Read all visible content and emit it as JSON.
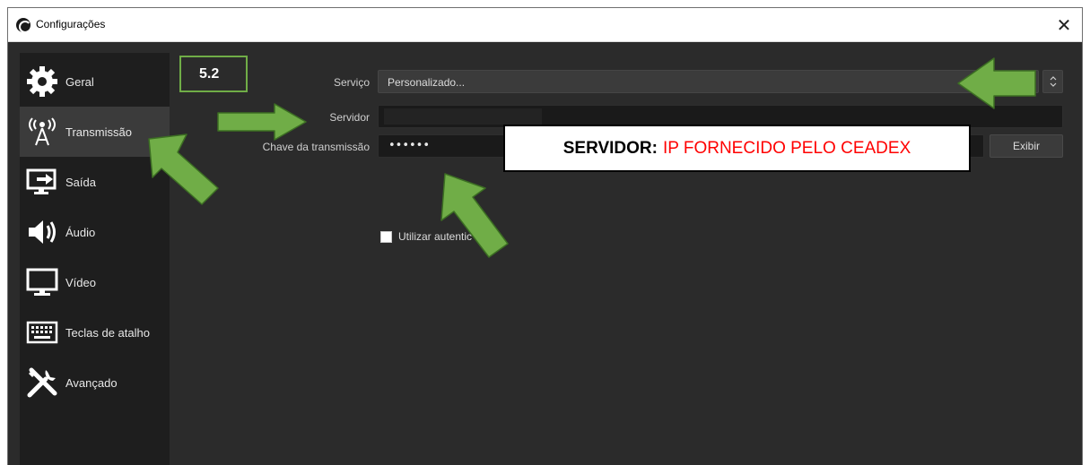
{
  "window": {
    "title": "Configurações",
    "close_symbol": "✕"
  },
  "sidebar": {
    "items": [
      {
        "label": "Geral",
        "icon": "gear-icon"
      },
      {
        "label": "Transmissão",
        "icon": "broadcast-antenna-icon",
        "active": true
      },
      {
        "label": "Saída",
        "icon": "output-monitor-icon"
      },
      {
        "label": "Áudio",
        "icon": "speaker-icon"
      },
      {
        "label": "Vídeo",
        "icon": "monitor-icon"
      },
      {
        "label": "Teclas de atalho",
        "icon": "keyboard-icon"
      },
      {
        "label": "Avançado",
        "icon": "tools-icon"
      }
    ]
  },
  "stream_settings": {
    "service_label": "Serviço",
    "service_value": "Personalizado...",
    "service_spin_symbol": "⌃⌄",
    "server_label": "Servidor",
    "server_value": "",
    "key_label": "Chave da transmissão",
    "key_value": "••••••",
    "show_button": "Exibir",
    "auth_label": "Utilizar autentic",
    "auth_checked": false
  },
  "annotations": {
    "step_badge": "5.2",
    "callout_prefix": "SERVIDOR:",
    "callout_text": "IP FORNECIDO PELO CEADEX",
    "arrow_color": "#70ad47",
    "callout_text_color": "#ff0000"
  },
  "colors": {
    "background": "#2b2b2b",
    "sidebar": "#1e1e1e",
    "active_item": "#3b3b3b",
    "field": "#1a1a1a"
  }
}
